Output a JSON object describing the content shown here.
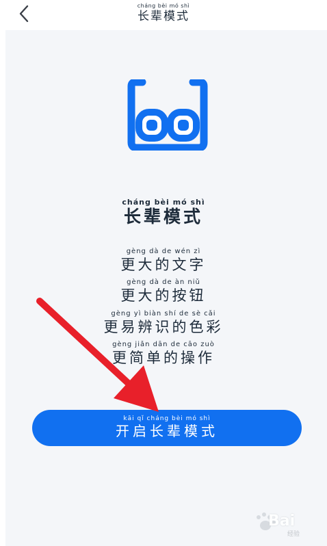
{
  "header": {
    "title_pinyin": "cháng bèi mó shì",
    "title": "长辈模式"
  },
  "hero": {
    "icon": "glasses-icon",
    "heading_pinyin": "cháng bèi mó shì",
    "heading": "长辈模式"
  },
  "features": [
    {
      "pinyin": "gèng dà de wén zì",
      "text": "更大的文字"
    },
    {
      "pinyin": "gèng dà de àn niǔ",
      "text": "更大的按钮"
    },
    {
      "pinyin": "gèng yì biàn shí de sè cǎi",
      "text": "更易辨识的色彩"
    },
    {
      "pinyin": "gèng jiǎn dān de cāo zuò",
      "text": "更简单的操作"
    }
  ],
  "action": {
    "pinyin": "kāi qǐ cháng bèi mó shì",
    "label": "开启长辈模式"
  },
  "watermark": {
    "text": "Bai",
    "sub": "经验"
  },
  "colors": {
    "accent": "#1170f0",
    "arrow": "#e8202a",
    "text": "#1d2b3a",
    "background": "#f4f6f9"
  }
}
